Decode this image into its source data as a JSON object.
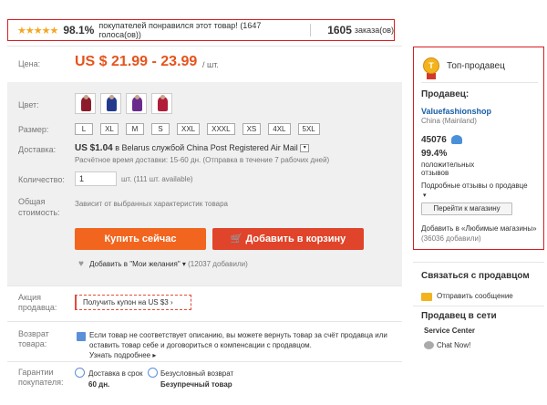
{
  "rating": {
    "stars": "★★★★★",
    "percent": "98.1%",
    "text": "покупателей понравился этот товар! (1647 голоса(ов))",
    "orders_count": "1605",
    "orders_label": "заказа(ов)"
  },
  "price": {
    "label": "Цена:",
    "value": "US $ 21.99 - 23.99",
    "unit": "/ шт."
  },
  "options": {
    "color_label": "Цвет:",
    "swatch_colors": [
      "#8c1c2c",
      "#233a8c",
      "#6a2a8c",
      "#b01e3a"
    ],
    "size_label": "Размер:",
    "sizes": [
      "L",
      "XL",
      "M",
      "S",
      "XXL",
      "XXXL",
      "XS",
      "4XL",
      "5XL"
    ],
    "delivery_label": "Доставка:",
    "delivery_price": "US $1.04",
    "delivery_text": "в  Belarus службой China Post Registered Air Mail",
    "delivery_sub": "Расчётное время доставки: 15-60 дн. (Отправка в течение 7 рабочих дней)",
    "qty_label": "Количество:",
    "qty_value": "1",
    "qty_unit": "шт. (111 шт. available)",
    "total_label_1": "Общая",
    "total_label_2": "стоимость:",
    "total_value": "Зависит от выбранных характеристик товара"
  },
  "actions": {
    "buy_now": "Купить сейчас",
    "add_to_cart": "Добавить в корзину",
    "wishlist_text": "Добавить в \"Мои желания\" ▾",
    "wishlist_count": "(12037 добавили)"
  },
  "promo": {
    "label_1": "Акция",
    "label_2": "продавца:",
    "coupon": "Получить купон на US $3 ›"
  },
  "returns": {
    "label_1": "Возврат",
    "label_2": "товара:",
    "text": "Если товар не соответствует описанию, вы можете вернуть товар за счёт продавца или оставить товар себе и договориться о компенсации с продавцом.",
    "more": "Узнать подробнее ▸"
  },
  "guarantees": {
    "label_1": "Гарантии",
    "label_2": "покупателя:",
    "g1_title": "Доставка в срок",
    "g1_value": "60 дн.",
    "g2_title": "Безусловный возврат",
    "g2_value": "Безупречный товар"
  },
  "seller": {
    "badge_title": "Топ-продавец",
    "medal_letter": "T",
    "seller_label": "Продавец:",
    "shop_name": "Valuefashionshop",
    "country": "China (Mainland)",
    "score": "45076",
    "positive_pct": "99.4%",
    "positive_label": "положительных",
    "positive_label_2": "отзывов",
    "detail_label": "Подробные отзывы о продавце",
    "caret": "▾",
    "go_to_shop": "Перейти к магазину",
    "favorites_text": "Добавить в «Любимые магазины»",
    "favorites_count": "(36036 добавили)"
  },
  "contact": {
    "title": "Связаться с продавцом",
    "send_message": "Отправить сообщение",
    "online_title": "Продавец в сети",
    "service_center": "Service Center",
    "chat_now": "Chat Now!"
  }
}
